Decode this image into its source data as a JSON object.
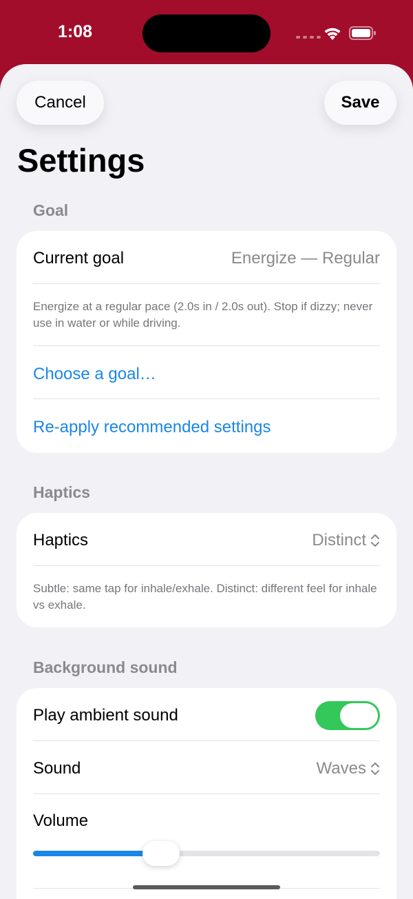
{
  "status": {
    "time": "1:08"
  },
  "nav": {
    "cancel_label": "Cancel",
    "save_label": "Save",
    "title": "Settings"
  },
  "goal_section": {
    "header": "Goal",
    "current_goal_label": "Current goal",
    "current_goal_value": "Energize — Regular",
    "description": "Energize at a regular pace (2.0s in / 2.0s out). Stop if dizzy; never use in water or while driving.",
    "choose_goal_link": "Choose a goal…",
    "reapply_link": "Re-apply recommended settings"
  },
  "haptics_section": {
    "header": "Haptics",
    "haptics_label": "Haptics",
    "haptics_value": "Distinct",
    "description": "Subtle: same tap for inhale/exhale. Distinct: different feel for inhale vs exhale."
  },
  "sound_section": {
    "header": "Background sound",
    "ambient_label": "Play ambient sound",
    "ambient_on": true,
    "sound_label": "Sound",
    "sound_value": "Waves",
    "volume_label": "Volume",
    "volume_level": 0.37
  },
  "colors": {
    "accent": "#1A86E8",
    "toggle_on": "#34C759",
    "status_bar": "#A10D2B",
    "background": "#F2F1F6"
  }
}
